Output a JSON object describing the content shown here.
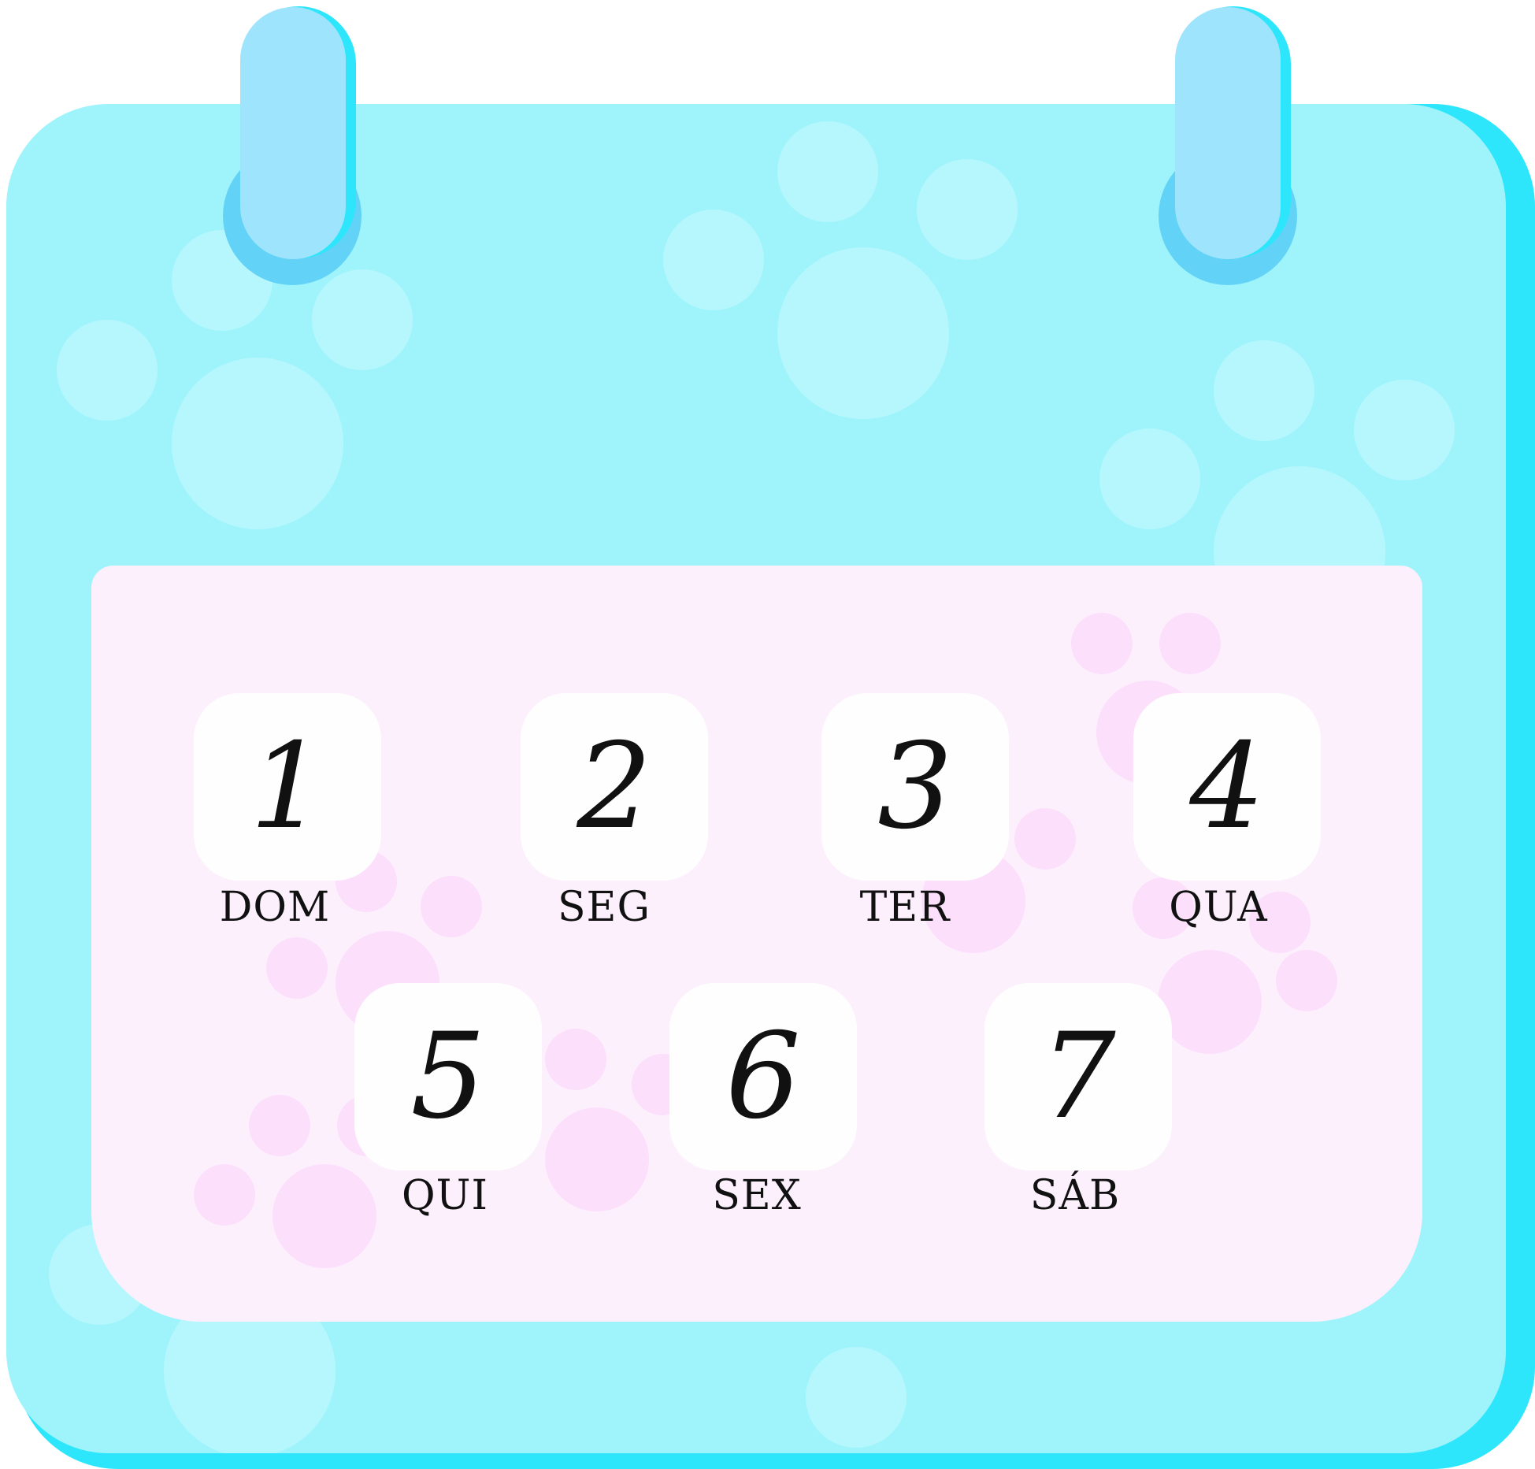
{
  "calendar": {
    "days": [
      {
        "number": "1",
        "label": "DOM"
      },
      {
        "number": "2",
        "label": "SEG"
      },
      {
        "number": "3",
        "label": "TER"
      },
      {
        "number": "4",
        "label": "QUA"
      },
      {
        "number": "5",
        "label": "QUI"
      },
      {
        "number": "6",
        "label": "SEX"
      },
      {
        "number": "7",
        "label": "SÁB"
      }
    ]
  },
  "colors": {
    "body": "#9ff4fc",
    "body_shadow": "#2ee6fb",
    "bubble": "#b5f7fd",
    "panel": "#fdf0fd",
    "paw": "#fcdffb",
    "clip": "#9fe4fd",
    "ring": "#62d3f6",
    "card": "#fefefe",
    "text": "#111111"
  }
}
